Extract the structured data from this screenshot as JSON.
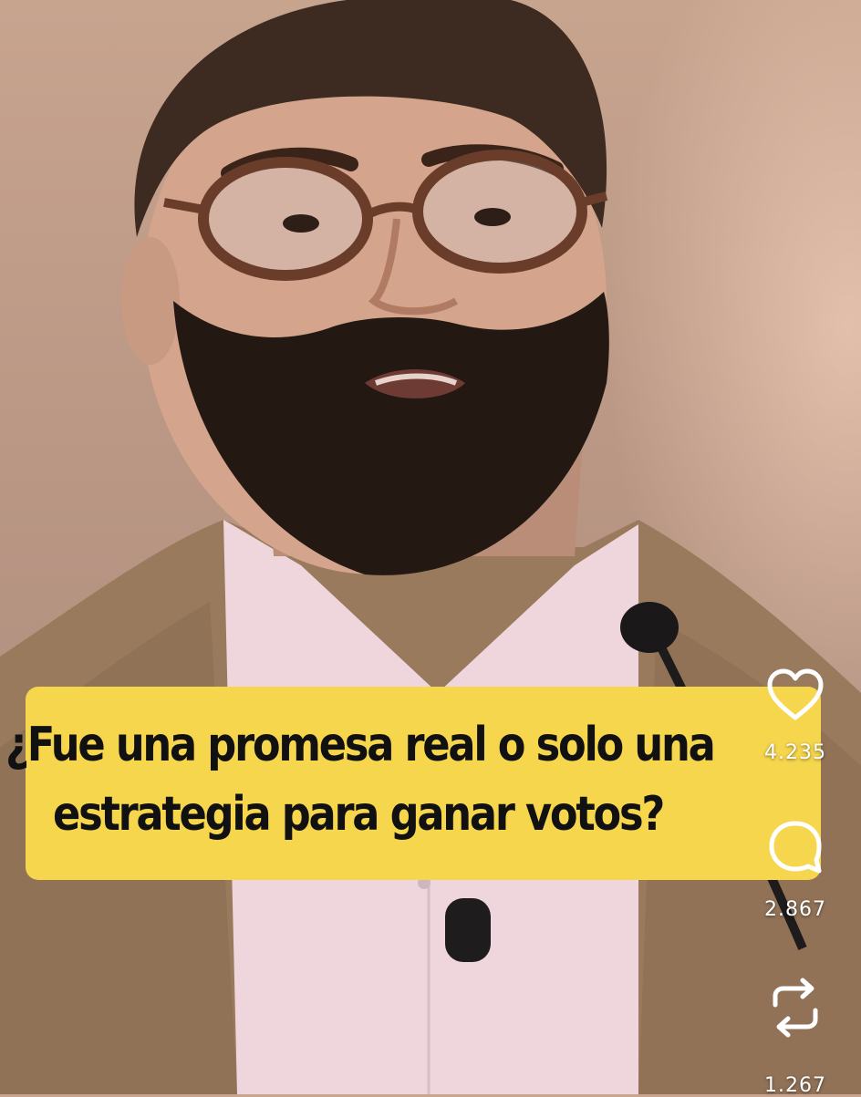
{
  "video": {
    "caption_lines": [
      "¿Fue una promesa real o solo una",
      "estrategia para ganar votos?"
    ]
  },
  "actions": {
    "like_icon": "heart-icon",
    "like_count": "4.235",
    "comment_icon": "comment-bubble-icon",
    "comment_count": "2.867",
    "repost_icon": "repost-arrows-icon",
    "repost_count": "1.267"
  },
  "colors": {
    "caption_background": "#f6d64c",
    "caption_text": "#111111",
    "icon_color": "#ffffff"
  }
}
